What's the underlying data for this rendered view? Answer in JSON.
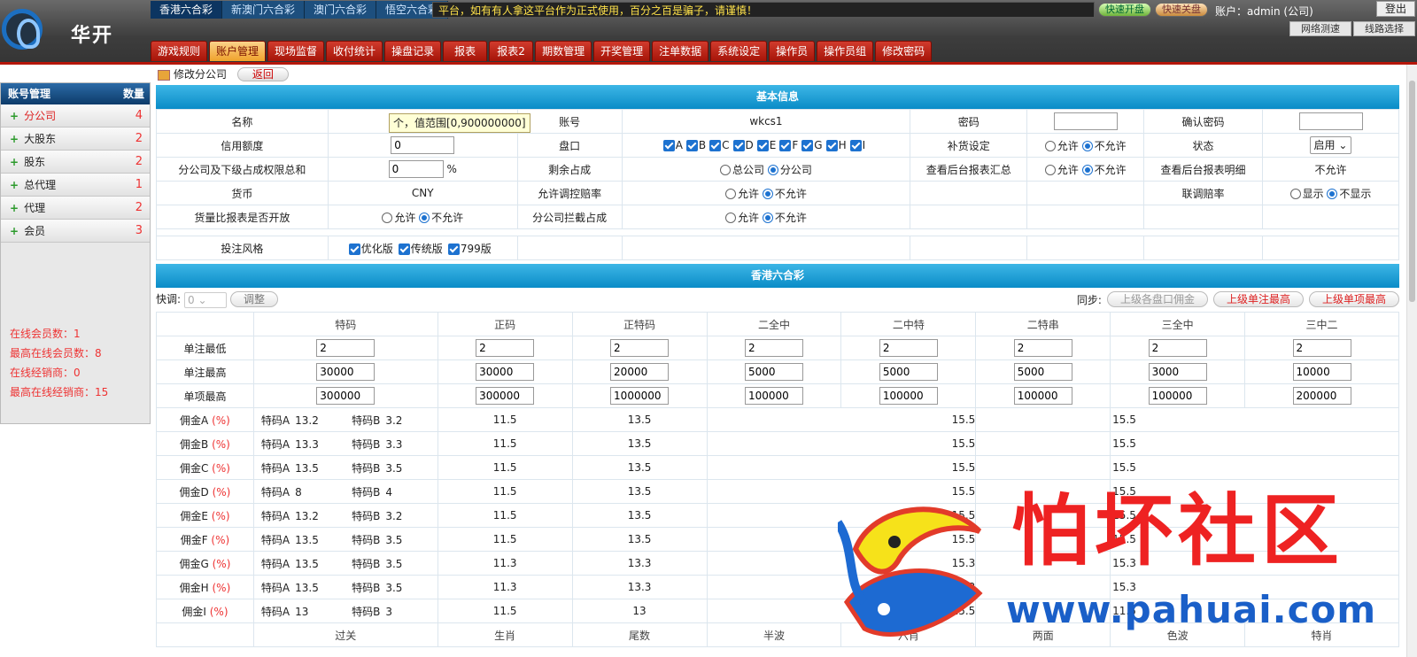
{
  "brand": {
    "name": "华开"
  },
  "game_tabs": [
    {
      "label": "香港六合彩",
      "active": true
    },
    {
      "label": "新澳门六合彩",
      "active": false
    },
    {
      "label": "澳门六合彩",
      "active": false
    },
    {
      "label": "悟空六合彩",
      "active": false
    }
  ],
  "notice": "平台，如有有人拿这平台作为正式使用，百分之百是骗子，请谨慎！",
  "header": {
    "open_label": "快速开盘",
    "close_label": "快速关盘",
    "account": "账户：admin (公司)",
    "logout": "登出",
    "speed_test": "网络测速",
    "line_select": "线路选择"
  },
  "nav_tabs": [
    {
      "label": "游戏规则"
    },
    {
      "label": "账户管理",
      "active": true
    },
    {
      "label": "现场监督"
    },
    {
      "label": "收付统计"
    },
    {
      "label": "操盘记录"
    },
    {
      "label": "报表"
    },
    {
      "label": "报表2"
    },
    {
      "label": "期数管理"
    },
    {
      "label": "开奖管理"
    },
    {
      "label": "注单数据"
    },
    {
      "label": "系统设定"
    },
    {
      "label": "操作员"
    },
    {
      "label": "操作员组"
    },
    {
      "label": "修改密码"
    }
  ],
  "sidebar": {
    "title": "账号管理",
    "count_label": "数量",
    "items": [
      {
        "label": "分公司",
        "count": "4"
      },
      {
        "label": "大股东",
        "count": "2"
      },
      {
        "label": "股东",
        "count": "2"
      },
      {
        "label": "总代理",
        "count": "1"
      },
      {
        "label": "代理",
        "count": "2"
      },
      {
        "label": "会员",
        "count": "3"
      }
    ],
    "stats": [
      "在线会员数：1",
      "最高在线会员数：8",
      "在线经销商：0",
      "最高在线经销商：15"
    ]
  },
  "breadcrumb": {
    "title": "修改分公司",
    "back": "返回"
  },
  "basic": {
    "section": "基本信息",
    "tooltip": "个，值范围[0,900000000]",
    "name_label": "名称",
    "account_label": "账号",
    "account_value": "wkcs1",
    "password_label": "密码",
    "confirm_label": "确认密码",
    "credit_label": "信用额度",
    "credit_value": "0",
    "pankou_label": "盘口",
    "pankou_options": [
      "A",
      "B",
      "C",
      "D",
      "E",
      "F",
      "G",
      "H",
      "I"
    ],
    "replenish_label": "补货设定",
    "allow": "允许",
    "deny": "不允许",
    "status_label": "状态",
    "status_value": "启用",
    "share_label": "分公司及下级占成权限总和",
    "share_value": "0",
    "pct": "%",
    "remain_label": "剩余占成",
    "remain_opt1": "总公司",
    "remain_opt2": "分公司",
    "report_sum_label": "查看后台报表汇总",
    "report_detail_label": "查看后台报表明细",
    "report_detail_value": "不允许",
    "currency_label": "货币",
    "currency_value": "CNY",
    "adjust_rate_label": "允许调控赔率",
    "link_rate_label": "联调赔率",
    "show": "显示",
    "hide": "不显示",
    "volume_label": "货量比报表是否开放",
    "intercept_label": "分公司拦截占成",
    "style_label": "投注风格",
    "styles": [
      "优化版",
      "传统版",
      "799版"
    ]
  },
  "hk": {
    "section": "香港六合彩",
    "fast_label": "快调:",
    "fast_value": "0",
    "adjust_btn": "调整",
    "sync_label": "同步:",
    "sync_btns": [
      "上级各盘口佣金",
      "上级单注最高",
      "上级单项最高"
    ],
    "columns": [
      "特码",
      "正码",
      "正特码",
      "二全中",
      "二中特",
      "二特串",
      "三全中",
      "三中二"
    ],
    "rows": [
      {
        "label": "单注最低",
        "values": [
          "2",
          "2",
          "2",
          "2",
          "2",
          "2",
          "2",
          "2"
        ]
      },
      {
        "label": "单注最高",
        "values": [
          "30000",
          "30000",
          "20000",
          "5000",
          "5000",
          "5000",
          "3000",
          "10000"
        ]
      },
      {
        "label": "单项最高",
        "values": [
          "300000",
          "300000",
          "1000000",
          "100000",
          "100000",
          "100000",
          "100000",
          "200000"
        ]
      }
    ],
    "rates": [
      {
        "label": "佣金A",
        "a": "13.2",
        "b": "3.2",
        "c2": "11.5",
        "c3": "13.5",
        "c5": "15.5",
        "c7": "15.5"
      },
      {
        "label": "佣金B",
        "a": "13.3",
        "b": "3.3",
        "c2": "11.5",
        "c3": "13.5",
        "c5": "15.5",
        "c7": "15.5"
      },
      {
        "label": "佣金C",
        "a": "13.5",
        "b": "3.5",
        "c2": "11.5",
        "c3": "13.5",
        "c5": "15.5",
        "c7": "15.5"
      },
      {
        "label": "佣金D",
        "a": "8",
        "b": "4",
        "c2": "11.5",
        "c3": "13.5",
        "c5": "15.5",
        "c7": "15.5"
      },
      {
        "label": "佣金E",
        "a": "13.2",
        "b": "3.2",
        "c2": "11.5",
        "c3": "13.5",
        "c5": "15.5",
        "c7": "15.5"
      },
      {
        "label": "佣金F",
        "a": "13.5",
        "b": "3.5",
        "c2": "11.5",
        "c3": "13.5",
        "c5": "15.5",
        "c7": "15.5"
      },
      {
        "label": "佣金G",
        "a": "13.5",
        "b": "3.5",
        "c2": "11.3",
        "c3": "13.3",
        "c5": "15.3",
        "c7": "15.3"
      },
      {
        "label": "佣金H",
        "a": "13.5",
        "b": "3.5",
        "c2": "11.3",
        "c3": "13.3",
        "c5": "15.3",
        "c7": "15.3"
      },
      {
        "label": "佣金I",
        "a": "13",
        "b": "3",
        "c2": "11.5",
        "c3": "13",
        "c5": "15.5",
        "c7": "11.5"
      }
    ],
    "rate_pct": "(%)",
    "ta": "特码A",
    "tb": "特码B",
    "columns2": [
      "过关",
      "生肖",
      "尾数",
      "半波",
      "六肖",
      "两面",
      "色波",
      "特肖"
    ]
  },
  "watermark": {
    "text": "怕坏社区",
    "url": "www.pahuai.com"
  },
  "colors": {
    "accent_red": "#b51709",
    "section_blue": "#0a8cc7",
    "nav_blue": "#1d4f7e"
  }
}
